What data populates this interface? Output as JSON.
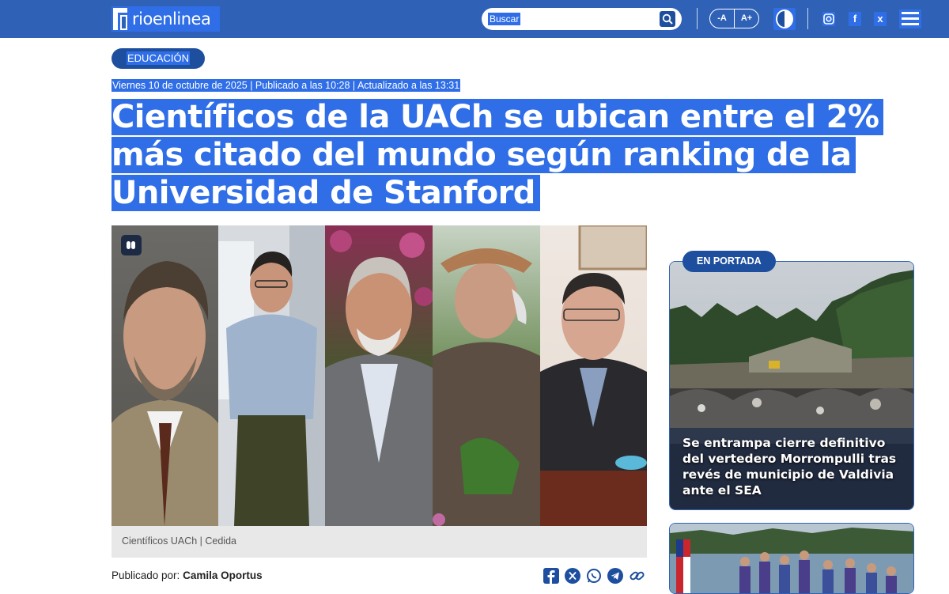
{
  "header": {
    "logo_text": "rioenlinea",
    "search_placeholder": "Buscar",
    "font_decrease": "-A",
    "font_increase": "A+",
    "social": [
      "instagram-icon",
      "facebook-icon",
      "x-icon"
    ],
    "brand_color": "#2f62b7",
    "highlight_color": "#2f6ee6"
  },
  "article": {
    "category": "EDUCACIÓN",
    "dateline": "Viernes 10 de octubre de 2025 | Publicado a las 10:28 | Actualizado a las 13:31",
    "title": "Científicos de la UACh se ubican entre el 2% más citado del mundo según ranking de la Universidad de Stanford",
    "image_caption": "Científicos UACh | Cedida",
    "byline_prefix": "Publicado por:",
    "author": "Camila Oportus",
    "share_icons": [
      "facebook-icon",
      "x-icon",
      "whatsapp-icon",
      "telegram-icon",
      "link-icon"
    ]
  },
  "sidebar": {
    "section_label": "EN PORTADA",
    "featured_title": "Se entrampa cierre definitivo del vertedero Morrompulli tras revés de municipio de Valdivia ante el SEA"
  }
}
